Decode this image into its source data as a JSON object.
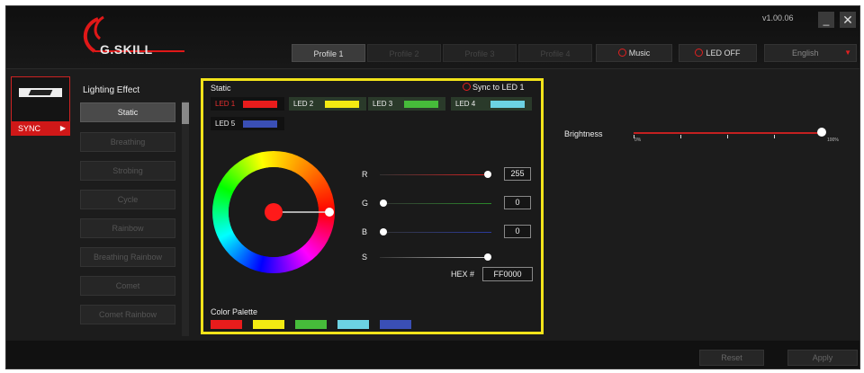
{
  "header": {
    "logo_text": "G.SKILL",
    "version": "v1.00.06",
    "min_label": "_",
    "close_label": "✕",
    "profiles": [
      "Profile 1",
      "Profile 2",
      "Profile 3",
      "Profile 4"
    ],
    "active_profile": "Profile 1",
    "music_label": "Music",
    "led_off_label": "LED OFF",
    "language": "English",
    "language_arrow": "▼"
  },
  "sidebar": {
    "sync_label": "SYNC",
    "sync_arrow": "▶"
  },
  "effects": {
    "title": "Lighting Effect",
    "items": [
      "Static",
      "Breathing",
      "Strobing",
      "Cycle",
      "Rainbow",
      "Breathing Rainbow",
      "Comet",
      "Comet Rainbow"
    ],
    "active": "Static"
  },
  "color_panel": {
    "title": "Static",
    "sync_label": "Sync to LED 1",
    "leds": [
      {
        "label": "LED 1",
        "color": "#e81c1c"
      },
      {
        "label": "LED 2",
        "color": "#f3ea12"
      },
      {
        "label": "LED 3",
        "color": "#46bc3a"
      },
      {
        "label": "LED 4",
        "color": "#6cd2e2"
      },
      {
        "label": "LED 5",
        "color": "#3a4fb5"
      }
    ],
    "sliders": {
      "r": {
        "label": "R",
        "value": "255",
        "level": 1.0,
        "color": "#e02020"
      },
      "g": {
        "label": "G",
        "value": "0",
        "level": 0.0,
        "color": "#2a8a2a"
      },
      "b": {
        "label": "B",
        "value": "0",
        "level": 0.0,
        "color": "#2a3aa0"
      },
      "s": {
        "label": "S",
        "level": 1.0,
        "color": "#dddddd"
      }
    },
    "hex_label": "HEX #",
    "hex_value": "FF0000",
    "selected_color": "#ff1a1a",
    "palette_title": "Color Palette",
    "palette": [
      "#e81c1c",
      "#f3ea12",
      "#46bc3a",
      "#6cd2e2",
      "#3a4fb5"
    ]
  },
  "brightness": {
    "label": "Brightness",
    "min_label": "0%",
    "max_label": "100%",
    "level": 1.0
  },
  "footer": {
    "reset_label": "Reset",
    "apply_label": "Apply"
  },
  "colors": {
    "accent_red": "#e02020",
    "highlight_yellow": "#f2e31a"
  }
}
